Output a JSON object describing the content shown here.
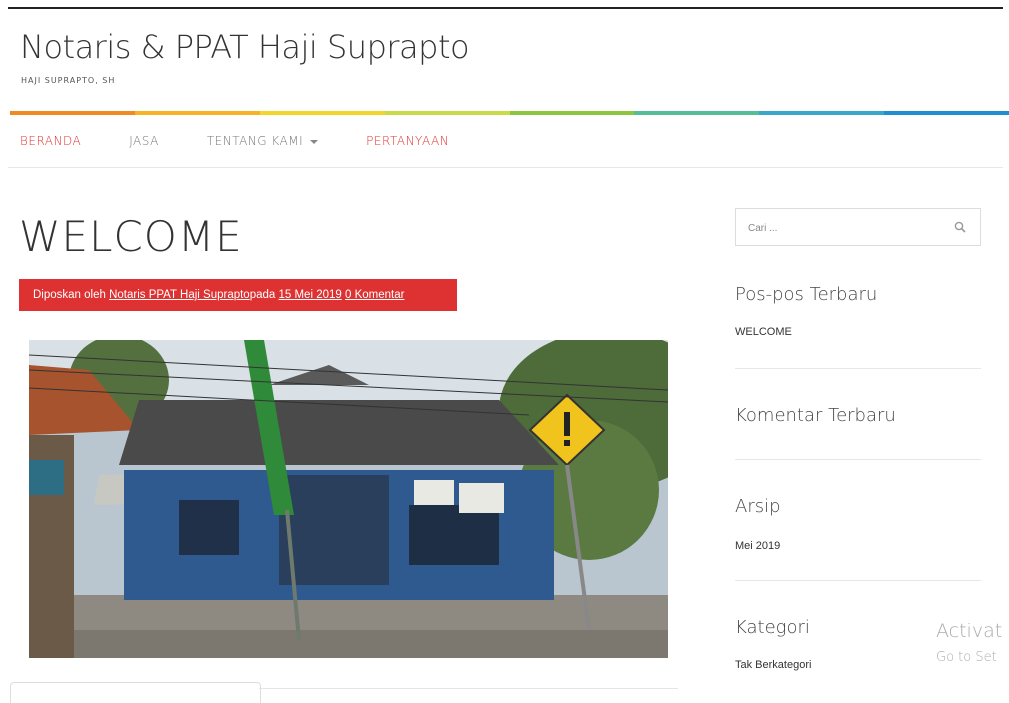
{
  "site": {
    "title": "Notaris & PPAT Haji Suprapto",
    "description": "HAJI SUPRAPTO, SH",
    "accent_color": "#e23333"
  },
  "colorbar": [
    "#ef8b22",
    "#f6b425",
    "#f2d72a",
    "#c9db46",
    "#8cc63e",
    "#55be96",
    "#38a7c9",
    "#1d8fd0"
  ],
  "nav": {
    "items": [
      {
        "label": "BERANDA",
        "color": "red"
      },
      {
        "label": "JASA",
        "color": "gray"
      },
      {
        "label": "TENTANG KAMI",
        "color": "gray",
        "dropdown": true
      },
      {
        "label": "PERTANYAAN",
        "color": "red"
      }
    ]
  },
  "post": {
    "title": "WELCOME",
    "meta": {
      "prefix": "Diposkan oleh ",
      "author": "Notaris PPAT Haji Suprapto",
      "date_prefix": "pada ",
      "date": "15 Mei 2019",
      "comments": "0 Komentar"
    },
    "image_icon": "street-view-building-photo"
  },
  "sidebar": {
    "search_placeholder": "Cari ...",
    "recent_posts": {
      "title": "Pos-pos Terbaru",
      "items": [
        "WELCOME"
      ]
    },
    "recent_comments": {
      "title": "Komentar Terbaru"
    },
    "archives": {
      "title": "Arsip",
      "items": [
        "Mei 2019"
      ]
    },
    "categories": {
      "title": "Kategori",
      "items": [
        "Tak Berkategori"
      ]
    }
  },
  "watermark": {
    "line1": "Activat",
    "line2": "Go to Set"
  }
}
